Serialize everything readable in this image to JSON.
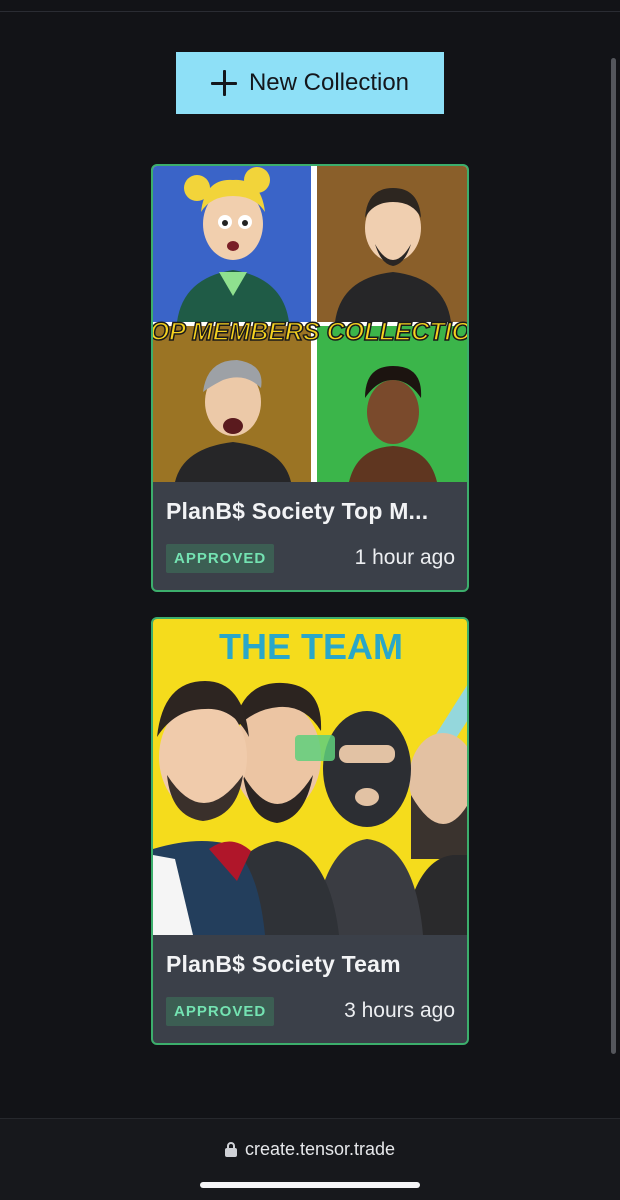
{
  "toolbar": {
    "new_collection_label": "New Collection",
    "new_collection_icon": "plus-icon"
  },
  "collections": [
    {
      "title": "PlanB$ Society Top M...",
      "status": "APPROVED",
      "time": "1 hour ago",
      "image_caption": "TOP MEMBERS COLLECTION"
    },
    {
      "title": "PlanB$ Society Team",
      "status": "APPROVED",
      "time": "3 hours ago",
      "image_caption": "THE TEAM"
    }
  ],
  "browser": {
    "url": "create.tensor.trade",
    "lock_icon": "lock-icon"
  },
  "colors": {
    "accent": "#8ee0f7",
    "card_border": "#3cae6c",
    "badge_bg": "#3c5e53",
    "badge_text": "#74e3b2",
    "background": "#121317"
  }
}
